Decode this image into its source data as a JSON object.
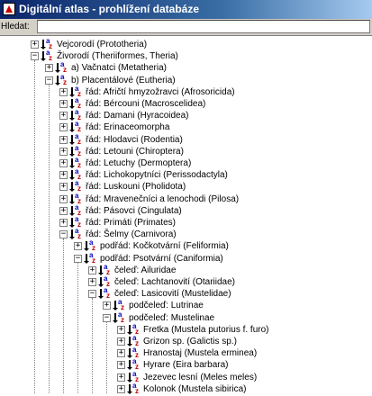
{
  "window": {
    "title": "Digitální atlas - prohlížení databáze"
  },
  "search": {
    "label": "Hledat:",
    "value": ""
  },
  "tree": [
    {
      "label": "Vejcorodí (Prototheria)",
      "expander": "+",
      "depth": 0
    },
    {
      "label": "Živorodí (Theriiformes, Theria)",
      "expander": "−",
      "depth": 0
    },
    {
      "label": "a) Vačnatci (Metatheria)",
      "expander": "+",
      "depth": 1
    },
    {
      "label": "b) Placentálové (Eutheria)",
      "expander": "−",
      "depth": 1
    },
    {
      "label": "řád: Afričtí hmyzožravci (Afrosoricida)",
      "expander": "+",
      "depth": 2
    },
    {
      "label": "řád: Bércouni (Macroscelidea)",
      "expander": "+",
      "depth": 2
    },
    {
      "label": "řád: Damani (Hyracoidea)",
      "expander": "+",
      "depth": 2
    },
    {
      "label": "řád: Erinaceomorpha",
      "expander": "+",
      "depth": 2
    },
    {
      "label": "řád: Hlodavci (Rodentia)",
      "expander": "+",
      "depth": 2
    },
    {
      "label": "řád: Letouni (Chiroptera)",
      "expander": "+",
      "depth": 2
    },
    {
      "label": "řád: Letuchy (Dermoptera)",
      "expander": "+",
      "depth": 2
    },
    {
      "label": "řád: Lichokopytníci (Perissodactyla)",
      "expander": "+",
      "depth": 2
    },
    {
      "label": "řád: Luskouni (Pholidota)",
      "expander": "+",
      "depth": 2
    },
    {
      "label": "řád: Mravenečníci a lenochodi (Pilosa)",
      "expander": "+",
      "depth": 2
    },
    {
      "label": "řád: Pásovci (Cingulata)",
      "expander": "+",
      "depth": 2
    },
    {
      "label": "řád: Primáti (Primates)",
      "expander": "+",
      "depth": 2
    },
    {
      "label": "řád: Šelmy (Carnivora)",
      "expander": "−",
      "depth": 2
    },
    {
      "label": "podřád: Kočkotvární (Feliformia)",
      "expander": "+",
      "depth": 3
    },
    {
      "label": "podřád: Psotvární (Caniformia)",
      "expander": "−",
      "depth": 3
    },
    {
      "label": "čeleď: Ailuridae",
      "expander": "+",
      "depth": 4
    },
    {
      "label": "čeleď: Lachtanovití (Otariidae)",
      "expander": "+",
      "depth": 4
    },
    {
      "label": "čeleď: Lasicovití (Mustelidae)",
      "expander": "−",
      "depth": 4
    },
    {
      "label": "podčeleď: Lutrinae",
      "expander": "+",
      "depth": 5
    },
    {
      "label": "podčeleď: Mustelinae",
      "expander": "−",
      "depth": 5
    },
    {
      "label": "Fretka (Mustela putorius f. furo)",
      "expander": "+",
      "depth": 6
    },
    {
      "label": "Grizon sp. (Galictis sp.)",
      "expander": "+",
      "depth": 6
    },
    {
      "label": "Hranostaj (Mustela erminea)",
      "expander": "+",
      "depth": 6
    },
    {
      "label": "Hyrare (Eira barbara)",
      "expander": "+",
      "depth": 6
    },
    {
      "label": "Jezevec lesní (Meles meles)",
      "expander": "+",
      "depth": 6
    },
    {
      "label": "Kolonok (Mustela sibirica)",
      "expander": "+",
      "depth": 6
    }
  ]
}
